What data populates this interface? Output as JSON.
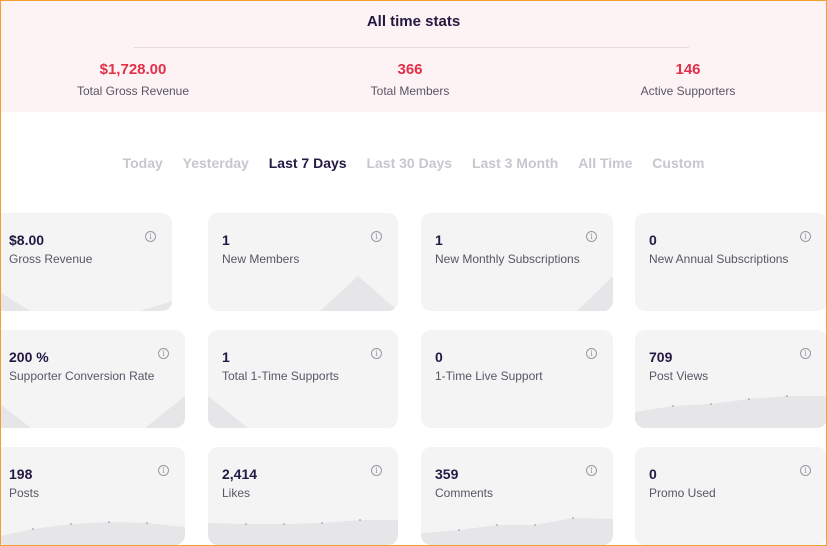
{
  "all_time": {
    "title": "All time stats",
    "stats": [
      {
        "value": "$1,728.00",
        "label": "Total Gross Revenue"
      },
      {
        "value": "366",
        "label": "Total Members"
      },
      {
        "value": "146",
        "label": "Active Supporters"
      }
    ]
  },
  "tabs": [
    {
      "label": "Today"
    },
    {
      "label": "Yesterday"
    },
    {
      "label": "Last 7 Days",
      "active": true
    },
    {
      "label": "Last 30 Days"
    },
    {
      "label": "Last 3 Month"
    },
    {
      "label": "All Time"
    },
    {
      "label": "Custom"
    }
  ],
  "cards": [
    {
      "value": "$8.00",
      "label": "Gross Revenue",
      "icon": "info-icon"
    },
    {
      "value": "1",
      "label": "New Members",
      "icon": "info-icon"
    },
    {
      "value": "1",
      "label": "New Monthly Subscriptions",
      "icon": "info-icon"
    },
    {
      "value": "0",
      "label": "New Annual Subscriptions",
      "icon": "info-icon"
    },
    {
      "value": "200 %",
      "label": "Supporter Conversion Rate",
      "icon": "info-icon"
    },
    {
      "value": "1",
      "label": "Total 1-Time Supports",
      "icon": "info-icon"
    },
    {
      "value": "0",
      "label": "1-Time Live Support",
      "icon": "info-icon"
    },
    {
      "value": "709",
      "label": "Post Views",
      "icon": "info-icon"
    },
    {
      "value": "198",
      "label": "Posts",
      "icon": "info-icon"
    },
    {
      "value": "2,414",
      "label": "Likes",
      "icon": "info-icon"
    },
    {
      "value": "359",
      "label": "Comments",
      "icon": "info-icon"
    },
    {
      "value": "0",
      "label": "Promo Used",
      "icon": "info-icon"
    }
  ],
  "colors": {
    "accent": "#e0304a",
    "title": "#231942",
    "inactive_tab": "#c9c6cf",
    "card_bg": "#f4f4f5",
    "chart_fill": "#e6e6e8"
  }
}
